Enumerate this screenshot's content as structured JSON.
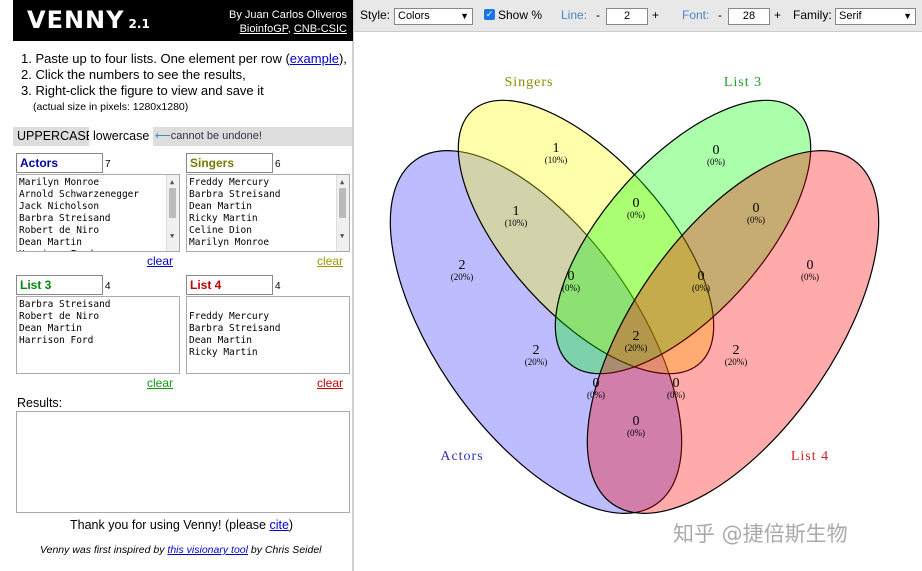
{
  "brand": {
    "name": "Venny",
    "version": "2.1",
    "author": "By Juan Carlos Oliveros",
    "link1": "BioinfoGP",
    "sep": ",",
    "link2": "CNB-CSIC"
  },
  "steps": {
    "s1_pre": "1. Paste up to four lists. One element per row (",
    "s1_link": "example",
    "s1_post": "),",
    "s2": "2. Click the numbers to see the results,",
    "s3": "3. Right-click the figure to view and save it",
    "s3_sub": "(actual size in pixels: 1280x1280)"
  },
  "case": {
    "upper": "UPPERCASE",
    "lower": "lowercase",
    "warning": "cannot be undone!"
  },
  "lists": [
    {
      "name": "Actors",
      "count": "7",
      "color": "#0000a0",
      "items": [
        "Marilyn Monroe",
        "Arnold Schwarzenegger",
        "Jack Nicholson",
        "Barbra Streisand",
        "Robert de Niro",
        "Dean Martin",
        "Harrison Ford"
      ],
      "clear": "clear",
      "clear_color": "#0000cc"
    },
    {
      "name": "Singers",
      "count": "6",
      "color": "#7a7a00",
      "items": [
        "Freddy Mercury",
        "Barbra Streisand",
        "Dean Martin",
        "Ricky Martin",
        "Celine Dion",
        "Marilyn Monroe"
      ],
      "clear": "clear",
      "clear_color": "#9a9a00"
    },
    {
      "name": "List 3",
      "count": "4",
      "color": "#008800",
      "items": [
        "Barbra Streisand",
        "Robert de Niro",
        "Dean Martin",
        "Harrison Ford"
      ],
      "clear": "clear",
      "clear_color": "#119911"
    },
    {
      "name": "List 4",
      "count": "4",
      "color": "#c00000",
      "items": [
        "",
        "Freddy Mercury",
        "Barbra Streisand",
        "Dean Martin",
        "Ricky Martin"
      ],
      "clear": "clear",
      "clear_color": "#cc0000"
    }
  ],
  "results_label": "Results:",
  "thanks": {
    "pre": "Thank you for using Venny!  (please ",
    "link": "cite",
    "post": ")"
  },
  "inspired": {
    "pre": "Venny was first inspired by ",
    "link": "this visionary tool",
    "post": " by Chris Seidel"
  },
  "toolbar": {
    "style_label": "Style:",
    "style_value": "Colors",
    "show_pct_label": "Show %",
    "line_label": "Line:",
    "line_value": "2",
    "font_label": "Font:",
    "font_value": "28",
    "family_label": "Family:",
    "family_value": "Serif",
    "minus": "-",
    "plus": "+"
  },
  "venn": {
    "set_labels": [
      {
        "text": "Actors",
        "color": "#3333aa"
      },
      {
        "text": "Singers",
        "color": "#8a8a00"
      },
      {
        "text": "List 3",
        "color": "#229922"
      },
      {
        "text": "List 4",
        "color": "#cc2222"
      }
    ],
    "set_colors": [
      "#3333ff",
      "#ffff00",
      "#00ff00",
      "#ff0000"
    ],
    "regions": [
      {
        "n": "1",
        "pct": "(10%)"
      },
      {
        "n": "0",
        "pct": "(0%)"
      },
      {
        "n": "1",
        "pct": "(10%)"
      },
      {
        "n": "0",
        "pct": "(0%)"
      },
      {
        "n": "0",
        "pct": "(0%)"
      },
      {
        "n": "2",
        "pct": "(20%)"
      },
      {
        "n": "0",
        "pct": "(0%)"
      },
      {
        "n": "0",
        "pct": "(0%)"
      },
      {
        "n": "0",
        "pct": "(0%)"
      },
      {
        "n": "2",
        "pct": "(20%)"
      },
      {
        "n": "2",
        "pct": "(20%)"
      },
      {
        "n": "2",
        "pct": "(20%)"
      },
      {
        "n": "0",
        "pct": "(0%)"
      },
      {
        "n": "0",
        "pct": "(0%)"
      },
      {
        "n": "0",
        "pct": "(0%)"
      }
    ]
  },
  "watermark": "知乎 @捷倍斯生物"
}
